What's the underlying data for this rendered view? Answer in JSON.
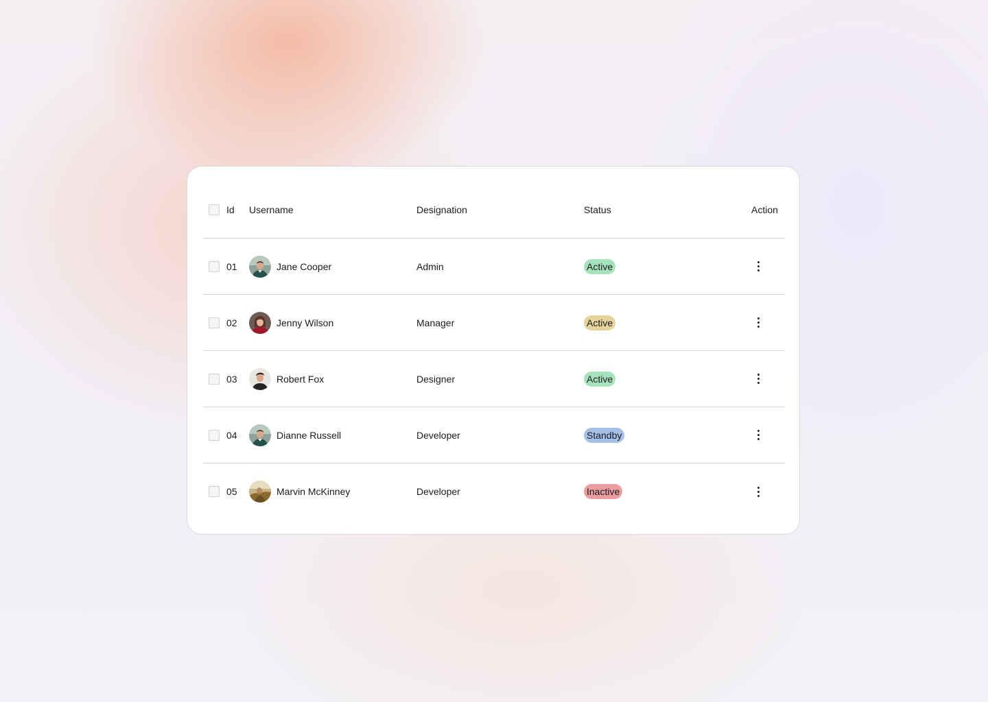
{
  "table": {
    "columns": {
      "id": "Id",
      "username": "Username",
      "designation": "Designation",
      "status": "Status",
      "action": "Action"
    },
    "rows": [
      {
        "id": "01",
        "username": "Jane Cooper",
        "designation": "Admin",
        "status": "Active",
        "status_bg": "#a6e3bd",
        "avatar": "avatar-man-green-shirt"
      },
      {
        "id": "02",
        "username": "Jenny Wilson",
        "designation": "Manager",
        "status": "Active",
        "status_bg": "#e6d49c",
        "avatar": "avatar-woman-red-top"
      },
      {
        "id": "03",
        "username": "Robert Fox",
        "designation": "Designer",
        "status": "Active",
        "status_bg": "#a6e3bd",
        "avatar": "avatar-man-dark-shirt"
      },
      {
        "id": "04",
        "username": "Dianne Russell",
        "designation": "Developer",
        "status": "Standby",
        "status_bg": "#a7c0e8",
        "avatar": "avatar-man-green-shirt"
      },
      {
        "id": "05",
        "username": "Marvin McKinney",
        "designation": "Developer",
        "status": "Inactive",
        "status_bg": "#ea9ea0",
        "avatar": "avatar-outdoor-photo"
      }
    ]
  },
  "colors": {
    "card_bg": "#ffffff",
    "divider": "#d6d6da",
    "text": "#1b1b1f"
  }
}
